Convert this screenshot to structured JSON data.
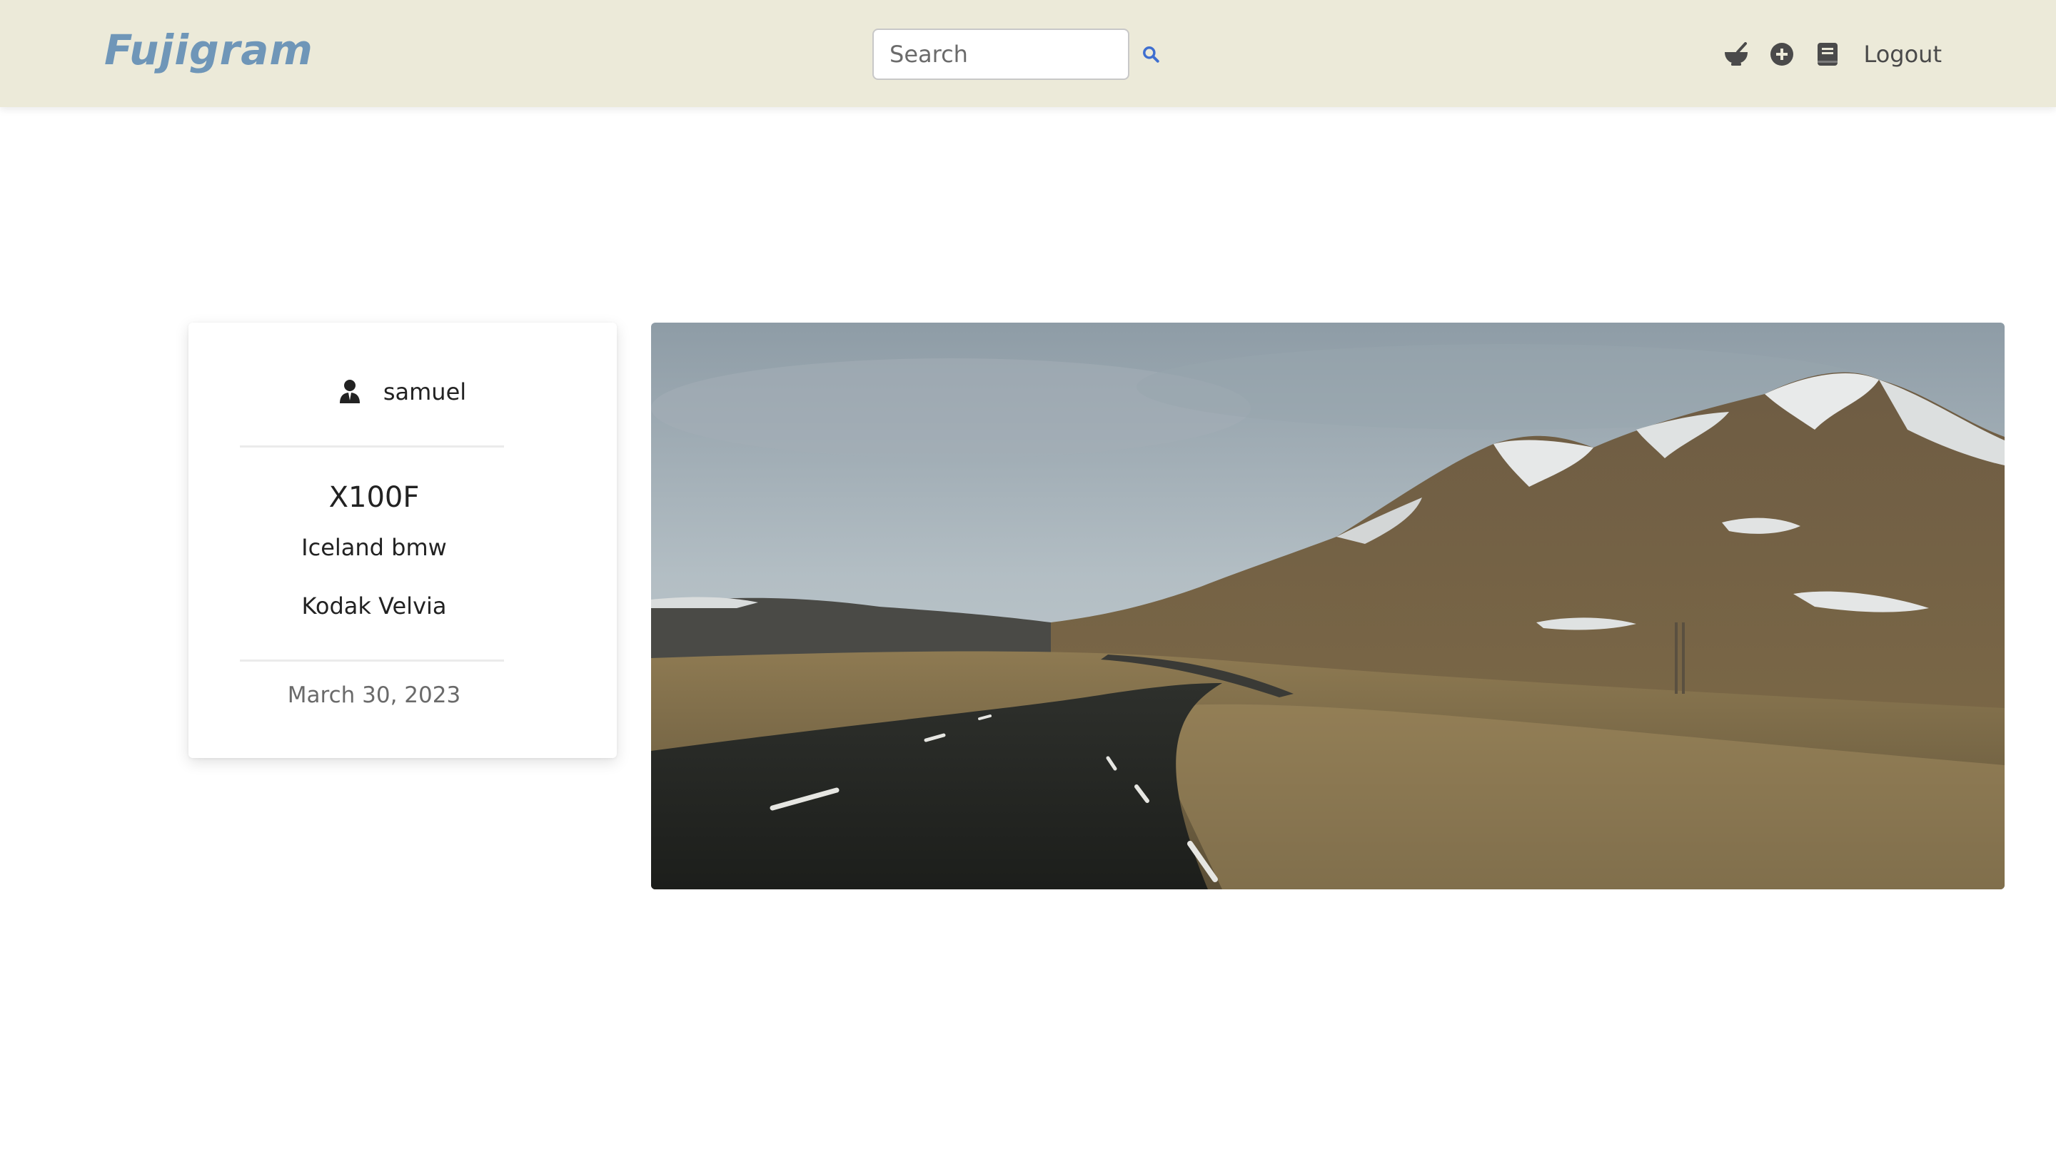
{
  "header": {
    "brand": "Fujigram",
    "search_placeholder": "Search",
    "logout_label": "Logout",
    "icons": [
      "search-icon",
      "mortar-bowl-icon",
      "plus-circle-icon",
      "book-icon"
    ]
  },
  "post": {
    "username": "samuel",
    "camera": "X100F",
    "title": "Iceland bmw",
    "film": "Kodak Velvia",
    "date": "March 30, 2023"
  },
  "colors": {
    "navbar_bg": "#ecead9",
    "brand": "#6f96b8",
    "search_icon": "#3f6fd0"
  }
}
